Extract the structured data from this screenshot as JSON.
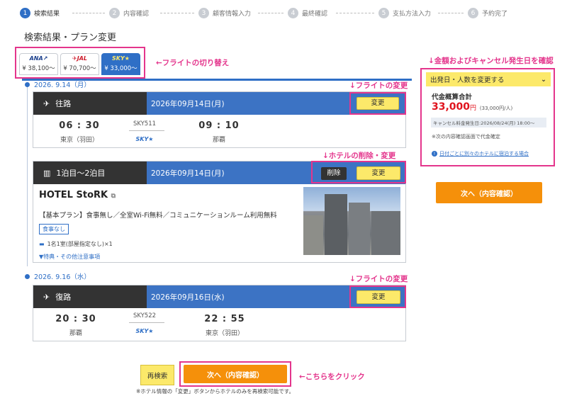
{
  "steps": [
    {
      "num": "1",
      "label": "検索結果"
    },
    {
      "num": "2",
      "label": "内容確認"
    },
    {
      "num": "3",
      "label": "顧客情報入力"
    },
    {
      "num": "4",
      "label": "最終確認"
    },
    {
      "num": "5",
      "label": "支払方法入力"
    },
    {
      "num": "6",
      "label": "予約完了"
    }
  ],
  "page_title": "検索結果・プラン変更",
  "tabs": [
    {
      "logo": "ANA↗",
      "price": "¥ 38,100〜"
    },
    {
      "logo": "✈JAL",
      "price": "¥ 70,700〜"
    },
    {
      "logo": "SKY★",
      "price": "¥ 33,000〜"
    }
  ],
  "annotations": {
    "switch_flight": "←フライトの切り替え",
    "change_flight_1": "↓フライトの変更",
    "change_hotel": "↓ホテルの削除・変更",
    "change_flight_2": "↓フライトの変更",
    "confirm_price": "↓金額およびキャンセル発生日を確認",
    "click_here": "←こちらをクリック"
  },
  "outbound": {
    "date_label": "2026. 9.14（月）",
    "title": "往路",
    "date": "2026年09月14日(月)",
    "change_label": "変更",
    "dep_time": "06 : 30",
    "dep_place": "東京（羽田）",
    "flight_no": "SKY511",
    "carrier": "SKY★",
    "arr_time": "09 : 10",
    "arr_place": "那覇"
  },
  "hotel": {
    "title": "1泊目〜2泊目",
    "date": "2026年09月14日(月)",
    "delete_label": "削除",
    "change_label": "変更",
    "name": "HOTEL StoRK",
    "plan": "【基本プラン】食事無し／全室Wi-Fi無料／コミュニケーションルーム利用無料",
    "tag": "食事なし",
    "room": "1名1室(部屋指定なし)×1",
    "link": "▼特典・その他注意事項"
  },
  "return": {
    "date_label": "2026. 9.16（水）",
    "title": "復路",
    "date": "2026年09月16日(水)",
    "change_label": "変更",
    "dep_time": "20 : 30",
    "dep_place": "那覇",
    "flight_no": "SKY522",
    "carrier": "SKY★",
    "arr_time": "22 : 55",
    "arr_place": "東京（羽田）"
  },
  "sidebar": {
    "header": "出発日・人数を変更する",
    "total_label": "代金概算合計",
    "total_amount": "33,000",
    "total_unit": "円",
    "total_per": "(33,000円/人)",
    "cancel_date": "キャンセル料金発生日:2026/08/24(月) 18:00〜",
    "note": "※次の内容確認画面で代金確定",
    "link": "日付ごとに別々のホテルに宿泊する場合",
    "next_button": "次へ（内容確認）"
  },
  "bottom": {
    "research": "再検索",
    "next": "次へ（内容確認）",
    "note": "※ホテル情報の「変更」ボタンからホテルのみを再検索可能です。"
  }
}
